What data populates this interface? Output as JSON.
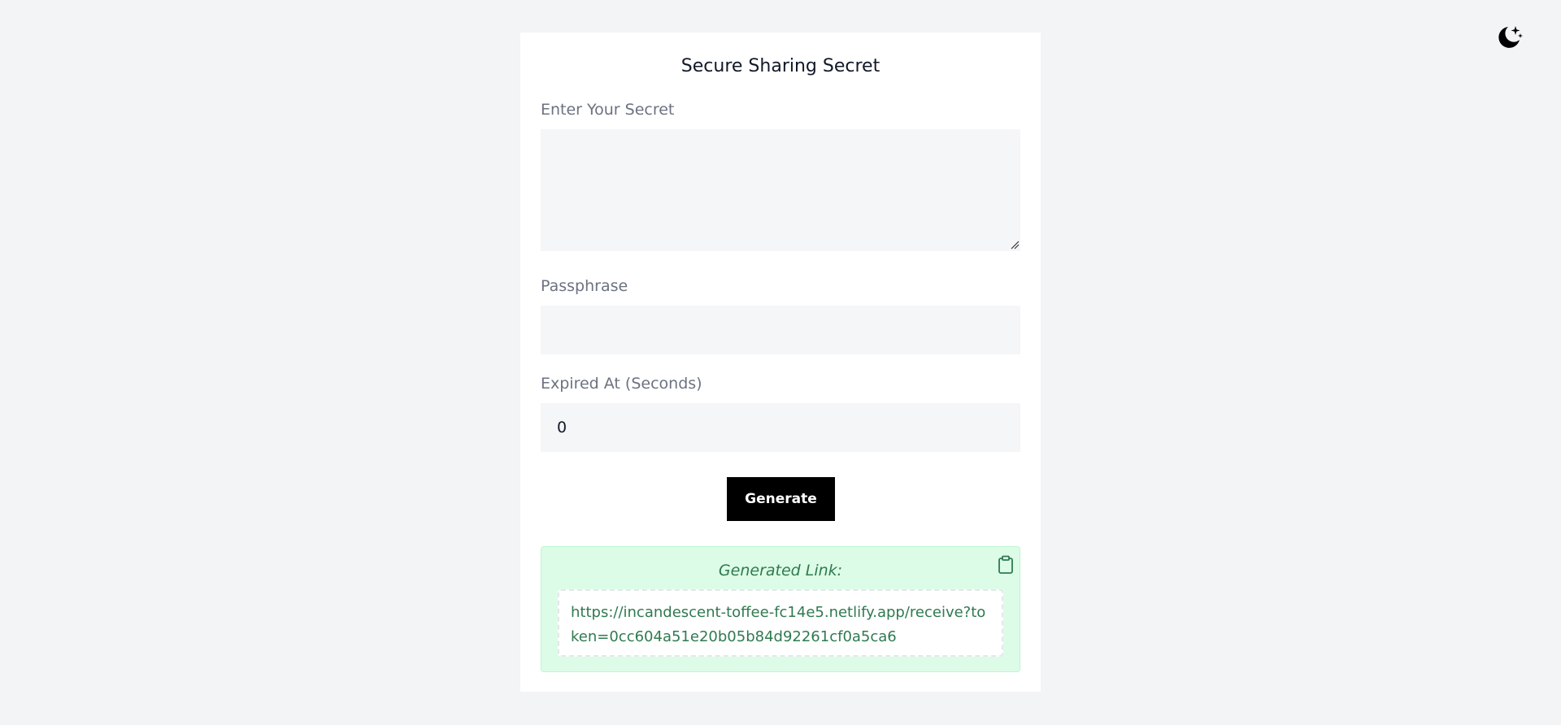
{
  "header": {
    "theme_icon": "moon-stars-icon"
  },
  "form": {
    "title": "Secure Sharing Secret",
    "secret_label": "Enter Your Secret",
    "secret_value": "",
    "passphrase_label": "Passphrase",
    "passphrase_value": "",
    "expired_label": "Expired At (Seconds)",
    "expired_value": "0",
    "generate_label": "Generate"
  },
  "result": {
    "title": "Generated Link:",
    "link": "https://incandescent-toffee-fc14e5.netlify.app/receive?token=0cc604a51e20b05b84d92261cf0a5ca6",
    "copy_icon": "clipboard-icon"
  },
  "colors": {
    "background": "#f3f4f6",
    "card": "#ffffff",
    "input_bg": "#f5f6f8",
    "button_bg": "#000000",
    "success_bg": "#dcfce7",
    "success_text": "#2f7a4f"
  }
}
